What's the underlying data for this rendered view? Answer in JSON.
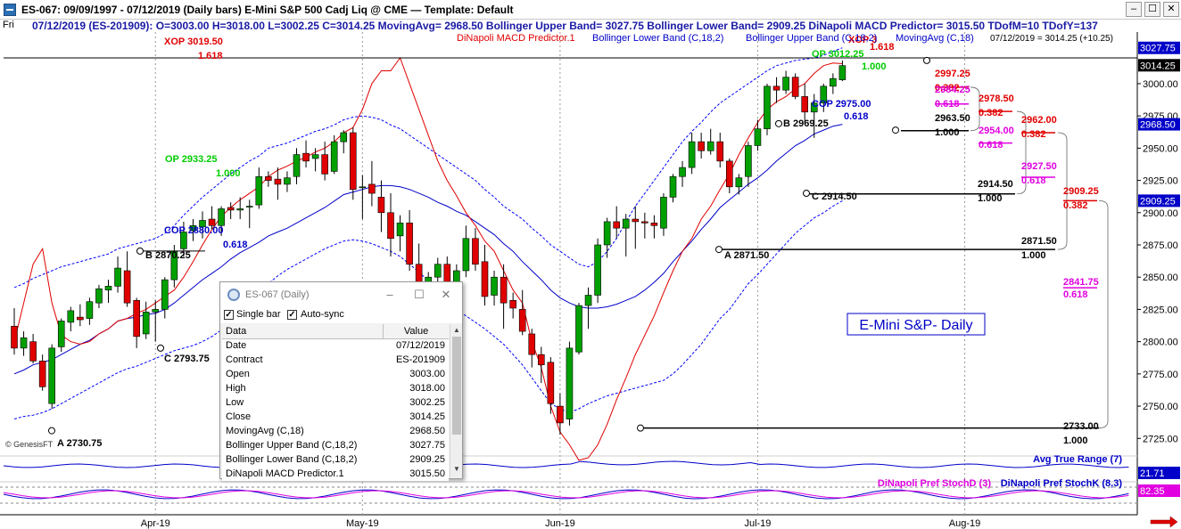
{
  "window": {
    "title": "ES-067:  09/09/1997 - 07/12/2019  (Daily bars)    E-Mini S&P 500 Cadj Liq @ CME  —  Template: Default",
    "minimize": "–",
    "maximize": "☐",
    "close": "✕"
  },
  "infobar": {
    "day": "Fri",
    "readout": "07/12/2019 (ES-201909):  O=3003.00  H=3018.00  L=3002.25  C=3014.25  MovingAvg= 2968.50  Bollinger Upper Band= 3027.75  Bollinger Lower Band= 2909.25  DiNapoli MACD Predictor= 3015.50  TDofM=10  TDofY=137"
  },
  "legend": {
    "macd": "DiNapoli MACD Predictor.1",
    "bb_lower": "Bollinger Lower Band (C,18,2)",
    "bb_upper": "Bollinger Upper Band (C,18,2)",
    "ma": "MovingAvg (C,18)",
    "last": "07/12/2019 = 3014.25 (+10.25)"
  },
  "chart_label": "E-Mini S&P- Daily",
  "copyright": "© GenesisFT",
  "colors": {
    "up": "#00a000",
    "down": "#e00000",
    "ma": "#0000c8",
    "bb": "#0000ff",
    "macd": "#e00000",
    "fib_red": "#e00000",
    "fib_magenta": "#e000e0",
    "fib_green": "#00cc00",
    "blue": "#0000c8",
    "axis_bg": "#ffffff"
  },
  "chart_data": {
    "type": "candlestick",
    "ylim": [
      2710,
      3040
    ],
    "y_ticks": [
      2725.0,
      2750.0,
      2775.0,
      2800.0,
      2825.0,
      2850.0,
      2875.0,
      2900.0,
      2925.0,
      2950.0,
      2975.0,
      3000.0
    ],
    "x_month_labels": [
      {
        "label": "Apr-19",
        "i": 15
      },
      {
        "label": "May-19",
        "i": 37
      },
      {
        "label": "Jun-19",
        "i": 58
      },
      {
        "label": "Jul-19",
        "i": 79
      },
      {
        "label": "Aug-19",
        "i": 101
      }
    ],
    "x_slots": 110,
    "bars": [
      [
        2812,
        2826,
        2790,
        2795
      ],
      [
        2795,
        2808,
        2789,
        2803
      ],
      [
        2800,
        2806,
        2783,
        2785
      ],
      [
        2785,
        2790,
        2762,
        2765
      ],
      [
        2752,
        2798,
        2748,
        2795
      ],
      [
        2796,
        2818,
        2792,
        2816
      ],
      [
        2815,
        2827,
        2808,
        2824
      ],
      [
        2819,
        2829,
        2812,
        2817
      ],
      [
        2818,
        2834,
        2813,
        2831
      ],
      [
        2830,
        2844,
        2826,
        2841
      ],
      [
        2840,
        2848,
        2830,
        2843
      ],
      [
        2843,
        2866,
        2838,
        2857
      ],
      [
        2855,
        2870,
        2827,
        2830
      ],
      [
        2832,
        2834,
        2795,
        2804
      ],
      [
        2806,
        2831,
        2802,
        2823
      ],
      [
        2823,
        2832,
        2800,
        2825
      ],
      [
        2825,
        2850,
        2818,
        2848
      ],
      [
        2848,
        2875,
        2842,
        2870
      ],
      [
        2872,
        2893,
        2866,
        2885
      ],
      [
        2886,
        2895,
        2878,
        2890
      ],
      [
        2889,
        2901,
        2880,
        2894
      ],
      [
        2895,
        2905,
        2887,
        2890
      ],
      [
        2890,
        2905,
        2882,
        2903
      ],
      [
        2904,
        2908,
        2895,
        2902
      ],
      [
        2902,
        2912,
        2895,
        2903
      ],
      [
        2905,
        2910,
        2888,
        2905
      ],
      [
        2906,
        2935,
        2903,
        2928
      ],
      [
        2928,
        2932,
        2920,
        2925
      ],
      [
        2926,
        2935,
        2910,
        2922
      ],
      [
        2922,
        2932,
        2916,
        2927
      ],
      [
        2928,
        2950,
        2922,
        2945
      ],
      [
        2946,
        2956,
        2935,
        2940
      ],
      [
        2942,
        2950,
        2932,
        2945
      ],
      [
        2945,
        2955,
        2925,
        2930
      ],
      [
        2932,
        2960,
        2930,
        2955
      ],
      [
        2955,
        2964,
        2946,
        2962
      ],
      [
        2962,
        2966,
        2910,
        2918
      ],
      [
        2920,
        2929,
        2895,
        2920
      ],
      [
        2922,
        2940,
        2905,
        2915
      ],
      [
        2912,
        2925,
        2885,
        2900
      ],
      [
        2900,
        2915,
        2866,
        2880
      ],
      [
        2882,
        2898,
        2870,
        2892
      ],
      [
        2892,
        2902,
        2855,
        2860
      ],
      [
        2860,
        2876,
        2818,
        2830
      ],
      [
        2830,
        2854,
        2805,
        2850
      ],
      [
        2850,
        2865,
        2844,
        2860
      ],
      [
        2860,
        2866,
        2835,
        2838
      ],
      [
        2840,
        2860,
        2830,
        2855
      ],
      [
        2855,
        2890,
        2850,
        2880
      ],
      [
        2880,
        2888,
        2855,
        2860
      ],
      [
        2862,
        2875,
        2828,
        2835
      ],
      [
        2836,
        2855,
        2828,
        2850
      ],
      [
        2850,
        2860,
        2810,
        2830
      ],
      [
        2832,
        2838,
        2818,
        2826
      ],
      [
        2825,
        2840,
        2805,
        2808
      ],
      [
        2806,
        2810,
        2780,
        2790
      ],
      [
        2790,
        2796,
        2768,
        2782
      ],
      [
        2784,
        2788,
        2744,
        2752
      ],
      [
        2750,
        2760,
        2728,
        2737
      ],
      [
        2740,
        2800,
        2735,
        2795
      ],
      [
        2792,
        2830,
        2790,
        2828
      ],
      [
        2828,
        2842,
        2810,
        2836
      ],
      [
        2836,
        2880,
        2830,
        2875
      ],
      [
        2875,
        2896,
        2865,
        2893
      ],
      [
        2893,
        2905,
        2880,
        2888
      ],
      [
        2888,
        2899,
        2866,
        2895
      ],
      [
        2895,
        2905,
        2872,
        2893
      ],
      [
        2893,
        2900,
        2880,
        2892
      ],
      [
        2892,
        2898,
        2880,
        2890
      ],
      [
        2888,
        2915,
        2882,
        2912
      ],
      [
        2912,
        2930,
        2908,
        2928
      ],
      [
        2928,
        2940,
        2920,
        2935
      ],
      [
        2935,
        2962,
        2930,
        2955
      ],
      [
        2955,
        2962,
        2942,
        2948
      ],
      [
        2948,
        2965,
        2945,
        2955
      ],
      [
        2955,
        2962,
        2935,
        2940
      ],
      [
        2940,
        2942,
        2915,
        2920
      ],
      [
        2920,
        2930,
        2914,
        2927
      ],
      [
        2928,
        2955,
        2920,
        2952
      ],
      [
        2952,
        2972,
        2948,
        2965
      ],
      [
        2965,
        3000,
        2960,
        2998
      ],
      [
        2998,
        3005,
        2985,
        2995
      ],
      [
        2995,
        3010,
        2992,
        3005
      ],
      [
        3005,
        3008,
        2988,
        2990
      ],
      [
        2990,
        3000,
        2970,
        2978
      ],
      [
        2978,
        2992,
        2958,
        2985
      ],
      [
        2985,
        3000,
        2978,
        2998
      ],
      [
        2998,
        3008,
        2992,
        3004
      ],
      [
        3003,
        3018,
        3002,
        3014
      ]
    ],
    "ma_values": [
      2775,
      2778,
      2782,
      2784,
      2786,
      2790,
      2794,
      2798,
      2801,
      2806,
      2810,
      2816,
      2818,
      2819,
      2821,
      2822,
      2825,
      2830,
      2836,
      2842,
      2848,
      2853,
      2858,
      2864,
      2869,
      2873,
      2877,
      2882,
      2885,
      2888,
      2892,
      2896,
      2900,
      2904,
      2909,
      2914,
      2916,
      2918,
      2920,
      2921,
      2921,
      2920,
      2918,
      2915,
      2912,
      2908,
      2905,
      2901,
      2898,
      2893,
      2888,
      2883,
      2876,
      2870,
      2862,
      2855,
      2848,
      2840,
      2834,
      2830,
      2827,
      2826,
      2826,
      2827,
      2829,
      2832,
      2835,
      2840,
      2846,
      2853,
      2862,
      2870,
      2878,
      2887,
      2895,
      2904,
      2910,
      2916,
      2922,
      2927,
      2933,
      2940,
      2946,
      2952,
      2956,
      2961,
      2964,
      2967,
      2968.5
    ],
    "bb_upper_values": [
      2842,
      2845,
      2849,
      2852,
      2855,
      2858,
      2860,
      2862,
      2864,
      2866,
      2868,
      2872,
      2874,
      2876,
      2878,
      2880,
      2884,
      2890,
      2898,
      2905,
      2912,
      2918,
      2924,
      2930,
      2935,
      2940,
      2944,
      2950,
      2952,
      2954,
      2957,
      2960,
      2963,
      2965,
      2968,
      2972,
      2974,
      2975,
      2974,
      2972,
      2968,
      2965,
      2960,
      2955,
      2950,
      2945,
      2940,
      2935,
      2930,
      2925,
      2918,
      2912,
      2905,
      2900,
      2895,
      2888,
      2882,
      2875,
      2870,
      2865,
      2860,
      2858,
      2862,
      2870,
      2880,
      2893,
      2905,
      2915,
      2925,
      2935,
      2945,
      2955,
      2963,
      2970,
      2978,
      2985,
      2990,
      2995,
      3000,
      3005,
      3010,
      3014,
      3016,
      3018,
      3019,
      3020,
      3022,
      3025,
      3027.75
    ],
    "bb_lower_values": [
      2740,
      2742,
      2743,
      2745,
      2748,
      2752,
      2756,
      2760,
      2764,
      2768,
      2772,
      2776,
      2779,
      2781,
      2784,
      2787,
      2790,
      2793,
      2795,
      2797,
      2800,
      2804,
      2809,
      2815,
      2822,
      2830,
      2837,
      2845,
      2851,
      2856,
      2860,
      2864,
      2868,
      2872,
      2875,
      2878,
      2879,
      2878,
      2876,
      2873,
      2870,
      2866,
      2860,
      2854,
      2847,
      2840,
      2832,
      2825,
      2820,
      2815,
      2810,
      2804,
      2798,
      2790,
      2782,
      2772,
      2762,
      2752,
      2748,
      2745,
      2748,
      2752,
      2755,
      2758,
      2760,
      2762,
      2764,
      2766,
      2768,
      2770,
      2775,
      2782,
      2790,
      2798,
      2808,
      2818,
      2825,
      2835,
      2845,
      2852,
      2860,
      2868,
      2876,
      2884,
      2890,
      2896,
      2900,
      2905,
      2909.25
    ],
    "macd_values": [
      2800,
      2830,
      2860,
      2872,
      2830,
      2805,
      2800,
      2798,
      2800,
      2806,
      2810,
      2816,
      2818,
      2822,
      2825,
      2830,
      2835,
      2840,
      2850,
      2862,
      2875,
      2887,
      2897,
      2904,
      2910,
      2915,
      2920,
      2928,
      2933,
      2936,
      2940,
      2943,
      2947,
      2950,
      2955,
      2962,
      2966,
      2980,
      3000,
      3010,
      3010,
      3020,
      3000,
      2980,
      2960,
      2940,
      2925,
      2913,
      2900,
      2890,
      2878,
      2870,
      2855,
      2840,
      2830,
      2800,
      2780,
      2750,
      2730,
      2720,
      2708,
      2710,
      2720,
      2736,
      2755,
      2772,
      2790,
      2805,
      2820,
      2838,
      2855,
      2870,
      2880,
      2895,
      2905,
      2918,
      2930,
      2945,
      2958,
      2970,
      2980,
      2986,
      2990,
      2996,
      3000,
      3008,
      3014,
      3016,
      3015.5
    ],
    "fib_levels": [
      {
        "text": "XOP 3019.50",
        "ratio": "1.618",
        "color": "red"
      },
      {
        "text": "OP 2933.25",
        "ratio": "1.000",
        "color": "green"
      },
      {
        "text": "COP 2880.00",
        "ratio": "0.618",
        "color": "blue"
      },
      {
        "text": "OP 3012.25",
        "ratio": "1.000",
        "color": "green"
      },
      {
        "text": "COP 2975.00",
        "ratio": "0.618",
        "color": "blue"
      },
      {
        "text": "XOP 3",
        "ratio": "1.618",
        "color": "red"
      },
      {
        "text": "2997.25",
        "ratio": "0.382",
        "color": "red"
      },
      {
        "text": "2984.25",
        "ratio": "0.618",
        "color": "magenta"
      },
      {
        "text": "2978.50",
        "ratio": "0.382",
        "color": "red"
      },
      {
        "text": "2962.00",
        "ratio": "0.382",
        "color": "red"
      },
      {
        "text": "2963.50",
        "ratio": "1.000",
        "color": "black"
      },
      {
        "text": "2954.00",
        "ratio": "0.618",
        "color": "magenta"
      },
      {
        "text": "2927.50",
        "ratio": "0.618",
        "color": "magenta"
      },
      {
        "text": "2914.50",
        "ratio": "1.000",
        "color": "black"
      },
      {
        "text": "2909.25",
        "ratio": "0.382",
        "color": "red"
      },
      {
        "text": "2871.50",
        "ratio": "1.000",
        "color": "black"
      },
      {
        "text": "2841.75",
        "ratio": "0.618",
        "color": "magenta"
      },
      {
        "text": "2733.00",
        "ratio": "1.000",
        "color": "black"
      }
    ],
    "pivots": [
      {
        "text": "A 2730.75"
      },
      {
        "text": "B 2870.25"
      },
      {
        "text": "C 2793.75"
      },
      {
        "text": "A 2871.50"
      },
      {
        "text": "B 2969.25"
      },
      {
        "text": "C 2914.50"
      }
    ],
    "price_tags": [
      {
        "text": "3027.75",
        "bg": "blue",
        "fg": "white"
      },
      {
        "text": "3014.25",
        "bg": "black",
        "fg": "white"
      },
      {
        "text": "2968.50",
        "bg": "blue",
        "fg": "white"
      },
      {
        "text": "2909.25",
        "bg": "blue",
        "fg": "white"
      }
    ],
    "atr": {
      "label": "Avg True Range (7)",
      "value": "21.71"
    },
    "stoch": {
      "label_d": "DiNapoli Pref StochD (3)",
      "label_k": "DiNapoli Pref StochK (8,3)",
      "value": "82.35"
    }
  },
  "data_window": {
    "title": "ES-067 (Daily)",
    "single_bar": "Single bar",
    "auto_sync": "Auto-sync",
    "col_data": "Data",
    "col_value": "Value",
    "rows": [
      {
        "k": "Date",
        "v": "07/12/2019"
      },
      {
        "k": "Contract",
        "v": "ES-201909"
      },
      {
        "k": "Open",
        "v": "3003.00"
      },
      {
        "k": "High",
        "v": "3018.00"
      },
      {
        "k": "Low",
        "v": "3002.25"
      },
      {
        "k": "Close",
        "v": "3014.25"
      },
      {
        "k": "MovingAvg (C,18)",
        "v": "2968.50"
      },
      {
        "k": "Bollinger Upper Band (C,18,2)",
        "v": "3027.75"
      },
      {
        "k": "Bollinger Lower Band (C,18,2)",
        "v": "2909.25"
      },
      {
        "k": "DiNapoli MACD Predictor.1",
        "v": "3015.50"
      }
    ]
  }
}
